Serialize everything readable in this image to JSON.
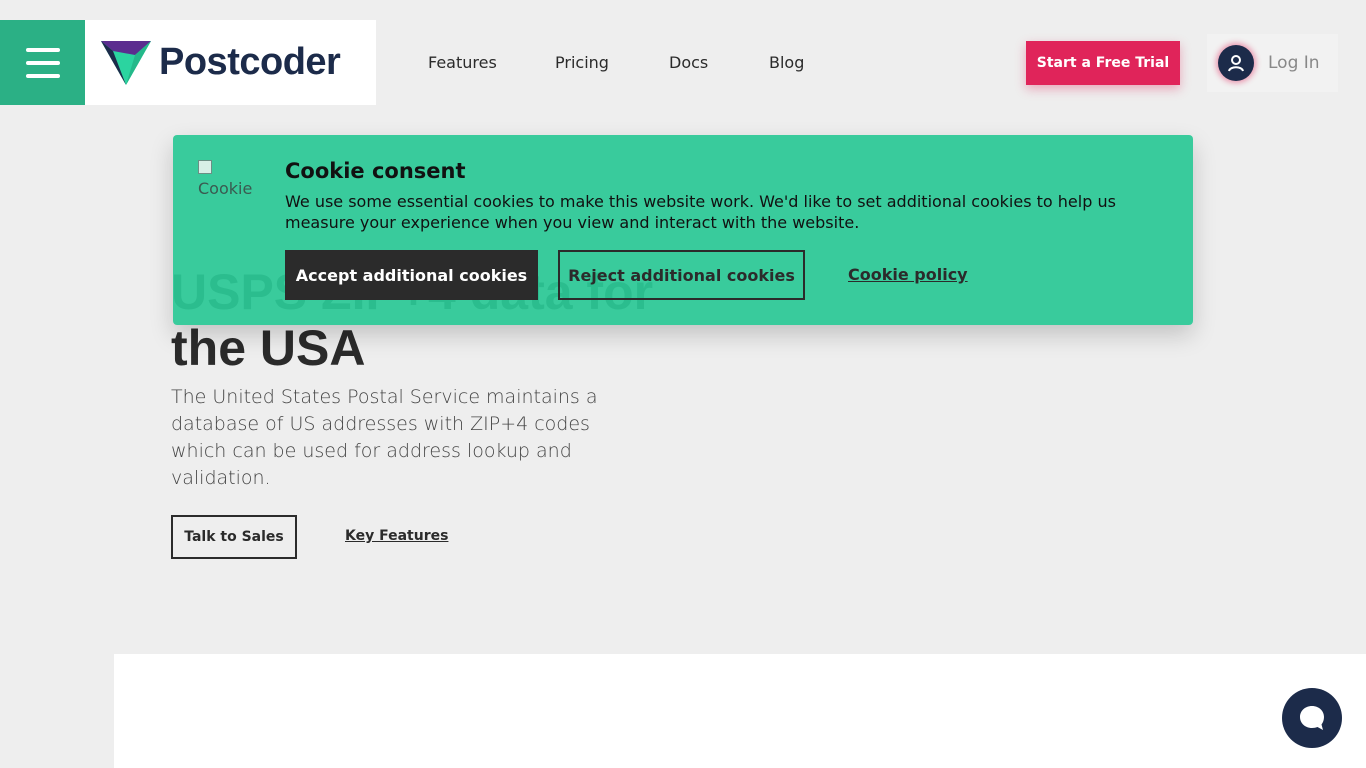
{
  "header": {
    "brand": "Postcoder",
    "nav": [
      "Features",
      "Pricing",
      "Docs",
      "Blog"
    ],
    "trial_label": "Start a Free Trial",
    "login_label": "Log In"
  },
  "hero": {
    "title": "USPS ZIP+4 data for the USA",
    "description": "The United States Postal Service maintains a database of US addresses with ZIP+4 codes which can be used for address lookup and validation.",
    "sales_label": "Talk to Sales",
    "features_label": "Key Features"
  },
  "cookie": {
    "image_alt": "Cookie",
    "title": "Cookie consent",
    "text": "We use some essential cookies to make this website work. We'd like to set additional cookies to help us measure your experience when you view and interact with the website.",
    "accept_label": "Accept additional cookies",
    "reject_label": "Reject additional cookies",
    "policy_label": "Cookie policy"
  },
  "colors": {
    "brand_green": "#2bb085",
    "cta_pink": "#e0245a",
    "navy": "#1c2b4a",
    "cookie_bg": "#38cba0"
  },
  "icons": {
    "menu": "hamburger-icon",
    "logo": "postcoder-v-logo",
    "user": "user-icon",
    "chat": "chat-bubble-icon"
  }
}
